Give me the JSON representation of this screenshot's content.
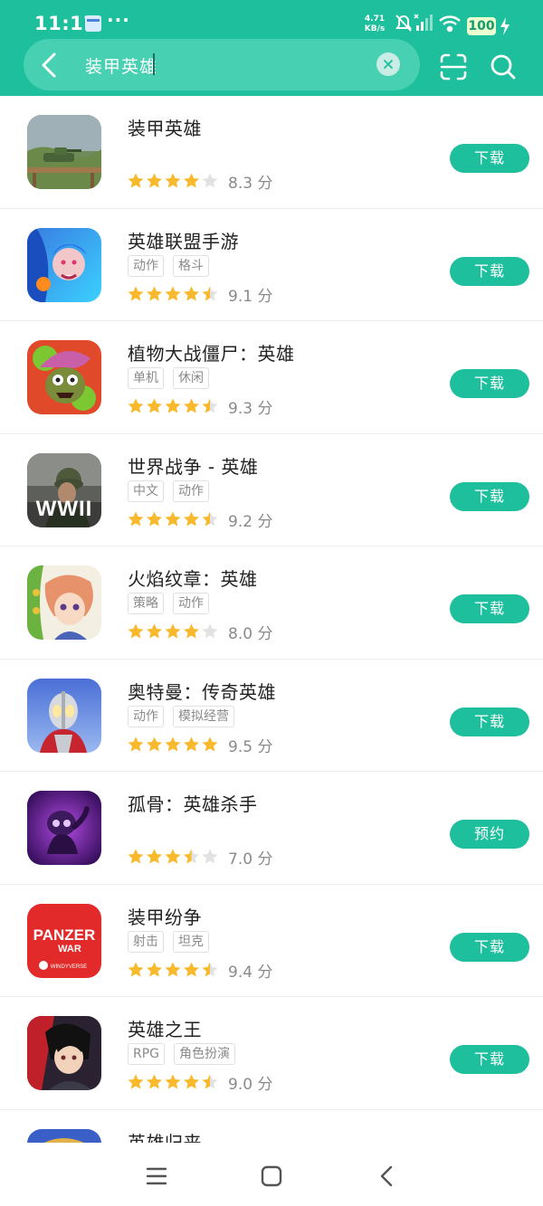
{
  "status": {
    "time": "11:17",
    "dots": "···",
    "speed_value": "4.71",
    "speed_unit": "KB/s",
    "battery": "100"
  },
  "search": {
    "query": "装甲英雄"
  },
  "colors": {
    "accent": "#1ebf9d",
    "star": "#f8b92c",
    "star_empty": "#e2e2e2"
  },
  "apps": [
    {
      "name": "装甲英雄",
      "tags": [],
      "stars": 4,
      "score": "8.3 分",
      "button": "下载",
      "icon": "tank-game-icon"
    },
    {
      "name": "英雄联盟手游",
      "tags": [
        "动作",
        "格斗"
      ],
      "stars": 4.5,
      "score": "9.1 分",
      "button": "下载",
      "icon": "league-game-icon"
    },
    {
      "name": "植物大战僵尸：英雄",
      "tags": [
        "单机",
        "休闲"
      ],
      "stars": 4.5,
      "score": "9.3 分",
      "button": "下载",
      "icon": "zombie-game-icon"
    },
    {
      "name": "世界战争 - 英雄",
      "tags": [
        "中文",
        "动作"
      ],
      "stars": 4.5,
      "score": "9.2 分",
      "button": "下载",
      "icon": "wwii-game-icon",
      "icon_text": "WWII"
    },
    {
      "name": "火焰纹章：英雄",
      "tags": [
        "策略",
        "动作"
      ],
      "stars": 4,
      "score": "8.0 分",
      "button": "下载",
      "icon": "fire-emblem-game-icon"
    },
    {
      "name": "奥特曼：传奇英雄",
      "tags": [
        "动作",
        "模拟经营"
      ],
      "stars": 5,
      "score": "9.5 分",
      "button": "下载",
      "icon": "ultraman-game-icon"
    },
    {
      "name": "孤骨：英雄杀手",
      "tags": [],
      "stars": 3.5,
      "score": "7.0 分",
      "button": "预约",
      "icon": "skul-game-icon"
    },
    {
      "name": "装甲纷争",
      "tags": [
        "射击",
        "坦克"
      ],
      "stars": 4.5,
      "score": "9.4 分",
      "button": "下载",
      "icon": "panzer-war-game-icon",
      "icon_text": "PANZER",
      "icon_text2": "WAR",
      "icon_text3": "WINDYVERSE"
    },
    {
      "name": "英雄之王",
      "tags": [
        "RPG",
        "角色扮演"
      ],
      "stars": 4.5,
      "score": "9.0 分",
      "button": "下载",
      "icon": "king-of-heroes-game-icon"
    },
    {
      "name": "英雄归来",
      "tags": [],
      "stars": 0,
      "score": "",
      "button": "",
      "icon": "hero-return-game-icon"
    }
  ]
}
